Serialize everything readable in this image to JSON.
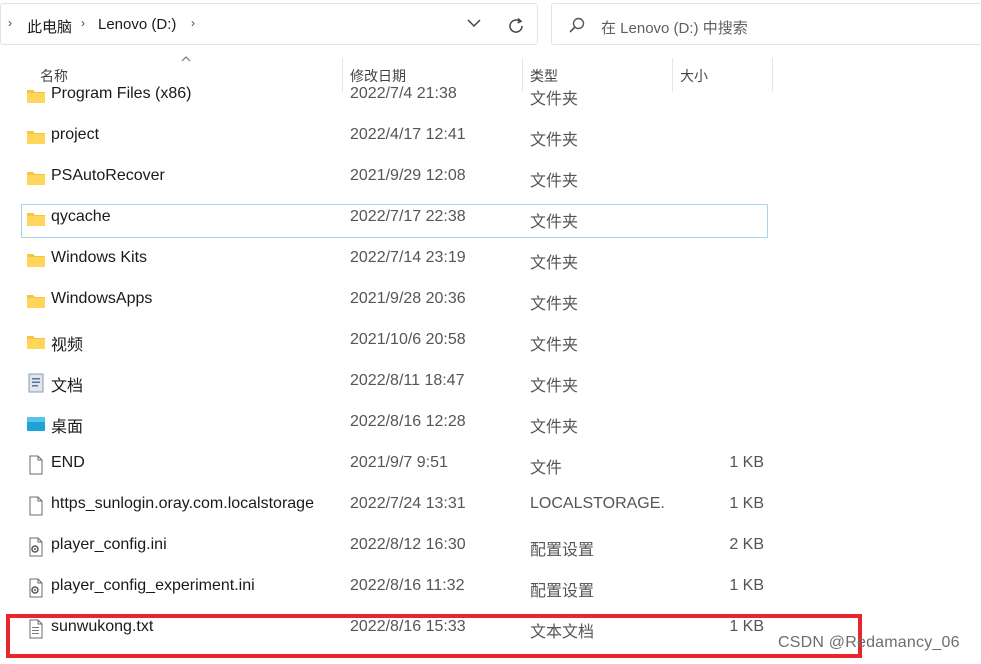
{
  "address_bar": {
    "crumbs": [
      "此电脑",
      "Lenovo (D:)"
    ]
  },
  "search": {
    "placeholder": "在 Lenovo (D:) 中搜索"
  },
  "columns": {
    "name": "名称",
    "modified": "修改日期",
    "type": "类型",
    "size": "大小"
  },
  "rows": [
    {
      "icon": "folder-icon",
      "name": "Program Files (x86)",
      "date": "2022/7/4 21:38",
      "type": "文件夹",
      "size": ""
    },
    {
      "icon": "folder-icon",
      "name": "project",
      "date": "2022/4/17 12:41",
      "type": "文件夹",
      "size": ""
    },
    {
      "icon": "folder-icon",
      "name": "PSAutoRecover",
      "date": "2021/9/29 12:08",
      "type": "文件夹",
      "size": ""
    },
    {
      "icon": "folder-icon",
      "name": "qycache",
      "date": "2022/7/17 22:38",
      "type": "文件夹",
      "size": ""
    },
    {
      "icon": "folder-icon",
      "name": "Windows Kits",
      "date": "2022/7/14 23:19",
      "type": "文件夹",
      "size": ""
    },
    {
      "icon": "folder-icon",
      "name": "WindowsApps",
      "date": "2021/9/28 20:36",
      "type": "文件夹",
      "size": ""
    },
    {
      "icon": "folder-icon",
      "name": "视频",
      "date": "2021/10/6 20:58",
      "type": "文件夹",
      "size": ""
    },
    {
      "icon": "documents-folder-icon",
      "name": "文档",
      "date": "2022/8/11 18:47",
      "type": "文件夹",
      "size": ""
    },
    {
      "icon": "desktop-folder-icon",
      "name": "桌面",
      "date": "2022/8/16 12:28",
      "type": "文件夹",
      "size": ""
    },
    {
      "icon": "blank-file-icon",
      "name": "END",
      "date": "2021/9/7 9:51",
      "type": "文件",
      "size": "1 KB"
    },
    {
      "icon": "blank-file-icon",
      "name": "https_sunlogin.oray.com.localstorage",
      "date": "2022/7/24 13:31",
      "type": "LOCALSTORAGE...",
      "size": "1 KB"
    },
    {
      "icon": "settings-file-icon",
      "name": "player_config.ini",
      "date": "2022/8/12 16:30",
      "type": "配置设置",
      "size": "2 KB"
    },
    {
      "icon": "settings-file-icon",
      "name": "player_config_experiment.ini",
      "date": "2022/8/16 11:32",
      "type": "配置设置",
      "size": "1 KB"
    },
    {
      "icon": "text-file-icon",
      "name": "sunwukong.txt",
      "date": "2022/8/16 15:33",
      "type": "文本文档",
      "size": "1 KB"
    }
  ],
  "watermark": "CSDN @Redamancy_06",
  "colors": {
    "highlight_border": "#e8262d",
    "focus_border": "#a6d7ea",
    "folder": "#f5c542"
  }
}
